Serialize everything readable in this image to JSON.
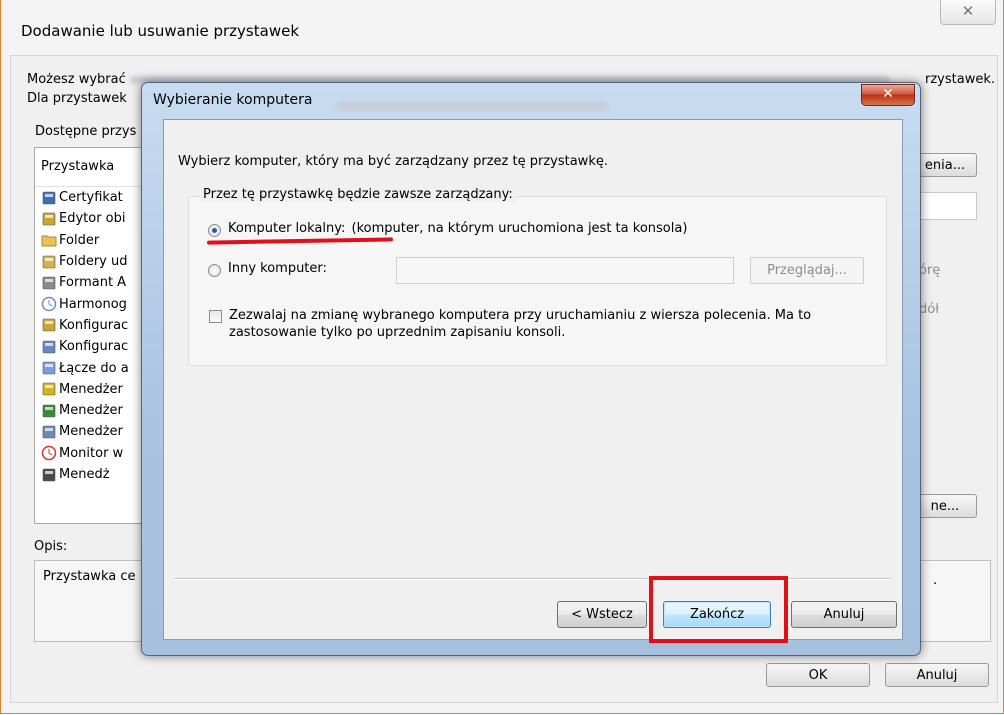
{
  "parent": {
    "title": "Dodawanie lub usuwanie przystawek",
    "close_glyph": "✕",
    "intro_line1": "Możesz wybrać",
    "intro_line1_tail": "rzystawek.",
    "intro_line2": "Dla przystawek",
    "available_label": "Dostępne przys",
    "list_header": "Przystawka",
    "snapins": [
      {
        "label": "Certyfikat",
        "icon": "certificate-icon"
      },
      {
        "label": "Edytor obi",
        "icon": "editor-icon"
      },
      {
        "label": "Folder",
        "icon": "folder-icon"
      },
      {
        "label": "Foldery ud",
        "icon": "shared-folders-icon"
      },
      {
        "label": "Formant A",
        "icon": "activex-icon"
      },
      {
        "label": "Harmonog",
        "icon": "scheduler-icon"
      },
      {
        "label": "Konfigurac",
        "icon": "config-lock-icon"
      },
      {
        "label": "Konfigurac",
        "icon": "config-analysis-icon"
      },
      {
        "label": "Łącze do a",
        "icon": "link-icon"
      },
      {
        "label": "Menedżer",
        "icon": "authorization-manager-icon"
      },
      {
        "label": "Menedżer",
        "icon": "computer-manager-icon"
      },
      {
        "label": "Menedżer",
        "icon": "device-manager-icon"
      },
      {
        "label": "Monitor w",
        "icon": "monitor-icon"
      },
      {
        "label": "Menedż",
        "icon": "printer-icon"
      }
    ],
    "btn_edit_ext": "enia...",
    "btn_up": "órę",
    "btn_down": "dół",
    "btn_advanced": "ne...",
    "desc_label": "Opis:",
    "desc_text": "Przystawka ce",
    "desc_tail": ".",
    "ok_label": "OK",
    "cancel_label": "Anuluj"
  },
  "dialog": {
    "title": "Wybieranie komputera",
    "close_glyph": "✕",
    "prompt": "Wybierz komputer, który ma być zarządzany przez tę przystawkę.",
    "group_legend": "Przez tę przystawkę będzie zawsze zarządzany:",
    "local_label": "Komputer lokalny:",
    "local_desc": "(komputer, na którym uruchomiona jest ta konsola)",
    "other_label": "Inny komputer:",
    "other_value": "",
    "browse_label": "Przeglądaj...",
    "allow_change_label": "Zezwalaj na zmianę wybranego komputera przy uruchamianiu z wiersza polecenia. Ma to zastosowanie tylko po uprzednim zapisaniu konsoli.",
    "allow_change_checked": false,
    "local_selected": true,
    "back_label": "< Wstecz",
    "finish_label": "Zakończ",
    "cancel_label": "Anuluj"
  },
  "colors": {
    "highlight_red": "#e0101a",
    "window_border": "#d9832e",
    "title_blue": "#a9c3e0"
  }
}
